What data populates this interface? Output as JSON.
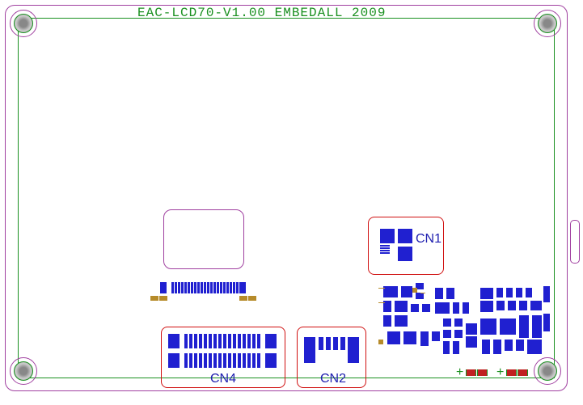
{
  "title": "EAC-LCD70-V1.00  EMBEDALL 2009",
  "connectors": {
    "cn1": {
      "label": "CN1"
    },
    "cn2": {
      "label": "CN2"
    },
    "cn4": {
      "label": "CN4"
    }
  },
  "leds": {
    "d1_plus": "+",
    "d2_plus": "+"
  }
}
